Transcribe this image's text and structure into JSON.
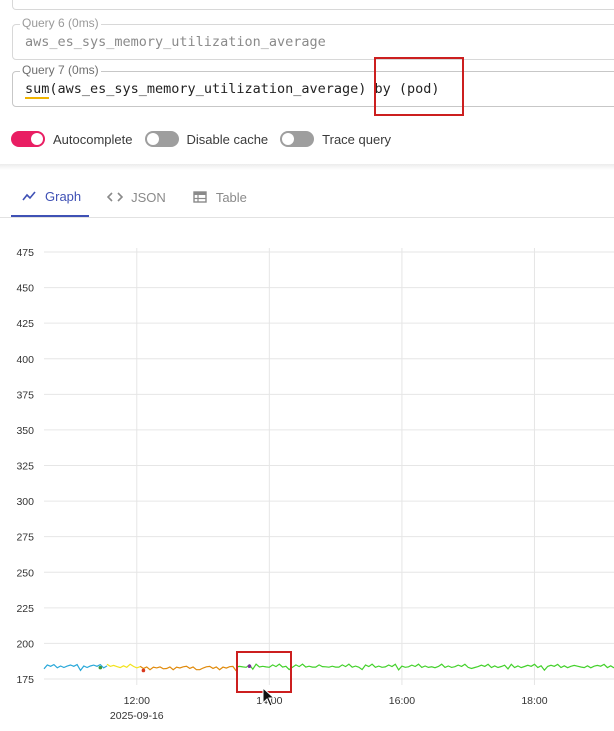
{
  "queries": [
    {
      "label": "Query 6 (0ms)",
      "text": "aws_es_sys_memory_utilization_average"
    },
    {
      "label": "Query 7 (0ms)",
      "fn": "sum",
      "rest": "(aws_es_sys_memory_utilization_average)",
      "by": " by (pod)"
    }
  ],
  "toggles": [
    {
      "label": "Autocomplete",
      "on": true
    },
    {
      "label": "Disable cache",
      "on": false
    },
    {
      "label": "Trace query",
      "on": false
    }
  ],
  "tabs": [
    {
      "label": "Graph",
      "icon": "line-chart-icon",
      "active": true
    },
    {
      "label": "JSON",
      "icon": "code-icon",
      "active": false
    },
    {
      "label": "Table",
      "icon": "table-icon",
      "active": false
    }
  ],
  "colors": {
    "accent": "#3f51b5",
    "toggle_on": "#e91e63",
    "highlight": "#cc1f1f"
  },
  "chart_data": {
    "type": "line",
    "ylim": [
      175,
      475
    ],
    "y_ticks": [
      175,
      200,
      225,
      250,
      275,
      300,
      325,
      350,
      375,
      400,
      425,
      450,
      475
    ],
    "x_ticks": [
      {
        "value": 12,
        "label": "12:00",
        "sublabel": "2025-09-16"
      },
      {
        "value": 14,
        "label": "14:00",
        "sublabel": ""
      },
      {
        "value": 16,
        "label": "16:00",
        "sublabel": ""
      },
      {
        "value": 18,
        "label": "18:00",
        "sublabel": ""
      }
    ],
    "xlim": [
      10.6,
      19.2
    ],
    "grid": true,
    "series": [
      {
        "color": "#29a8d9",
        "x_start": 10.6,
        "x_end": 11.55,
        "level": 184
      },
      {
        "color": "#f2e31b",
        "x_start": 11.55,
        "x_end": 12.05,
        "level": 184
      },
      {
        "color": "#e08a0b",
        "x_start": 12.05,
        "x_end": 13.5,
        "level": 183
      },
      {
        "color": "#43d12b",
        "x_start": 13.5,
        "x_end": 19.2,
        "level": 184
      }
    ],
    "points": [
      {
        "x": 11.45,
        "y": 183,
        "color": "#3c9a3c"
      },
      {
        "x": 12.1,
        "y": 181,
        "color": "#d9381e"
      },
      {
        "x": 13.7,
        "y": 184,
        "color": "#7a2b9c"
      }
    ]
  }
}
